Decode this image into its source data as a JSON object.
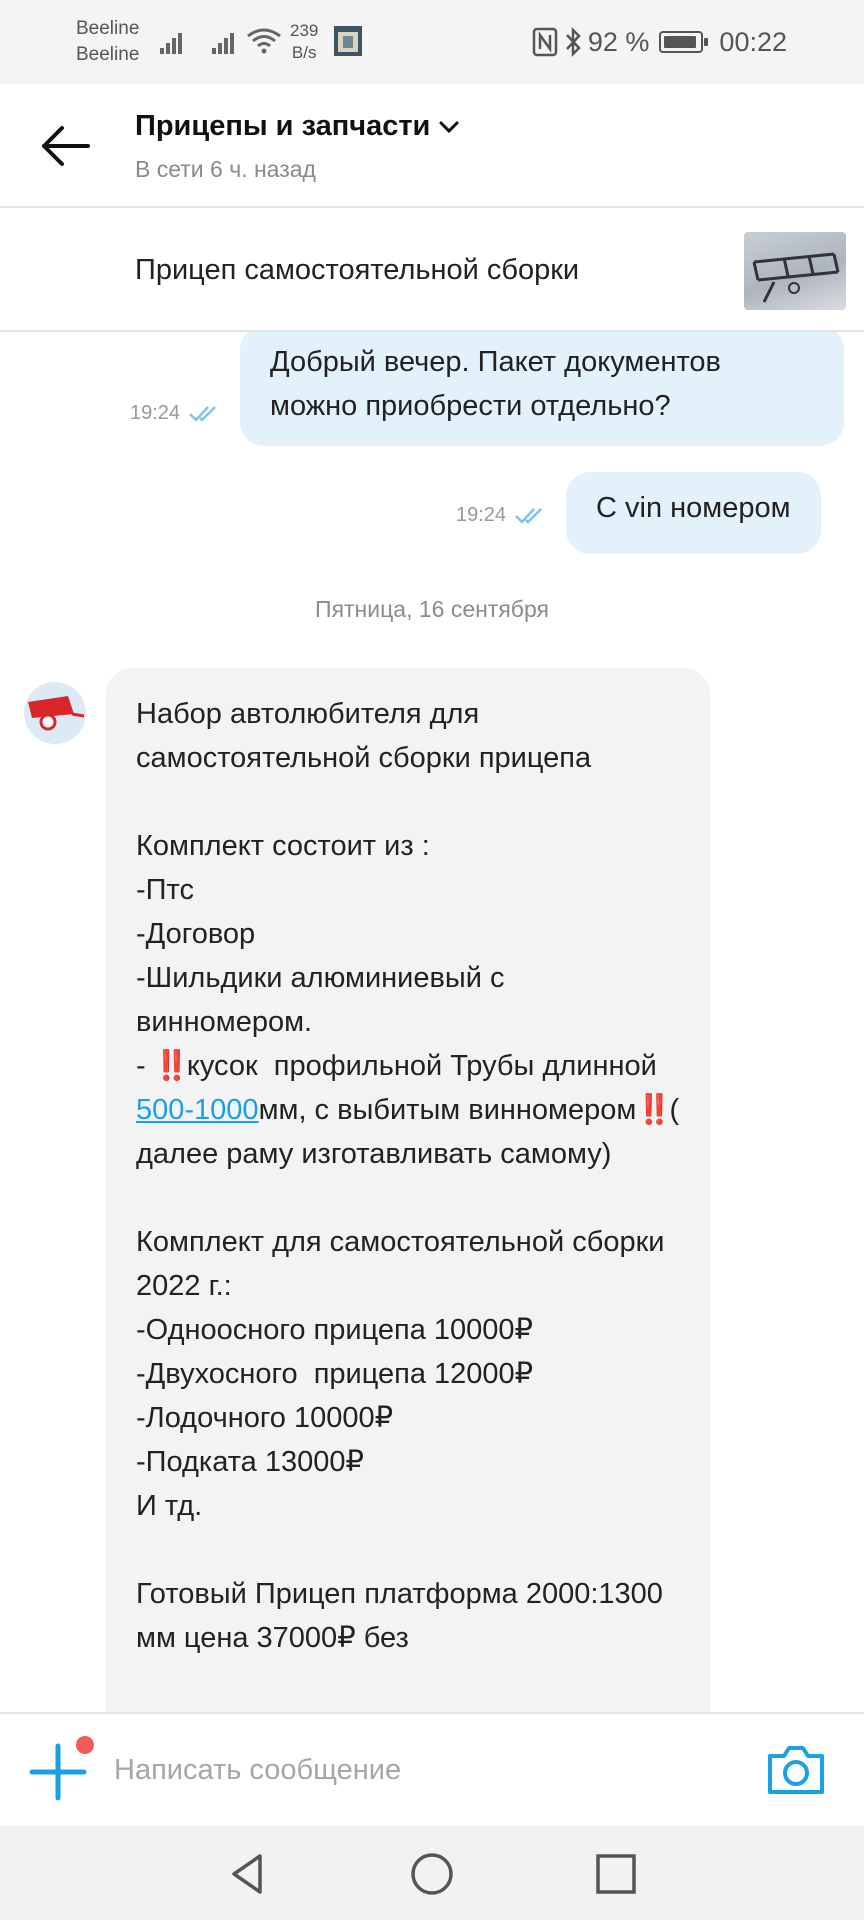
{
  "status_bar": {
    "carrier_1": "Beeline",
    "carrier_2": "Beeline",
    "net_speed_value": "239",
    "net_speed_unit": "B/s",
    "battery_text": "92 %",
    "battery_level": 0.92,
    "time": "00:22"
  },
  "header": {
    "title": "Прицепы и запчасти",
    "subtitle": "В сети 6 ч. назад"
  },
  "ad": {
    "title": "Прицеп самостоятельной сборки"
  },
  "messages": {
    "outgoing": [
      {
        "text": "Добрый вечер. Пакет документов можно приобрести отдельно?",
        "time": "19:24"
      },
      {
        "text": "С vin номером",
        "time": "19:24"
      }
    ],
    "date_separator": "Пятница, 16 сентября",
    "incoming": {
      "intro": "Набор автолюбителя для самостоятельной сборки прицепа\n\nКомплект состоит из :\n-Птс\n-Договор\n-Шильдики алюминиевый с винномером.\n- ",
      "bang_1": "‼️",
      "part_2": "кусок  профильной Трубы длинной ",
      "link": "500-1000",
      "part_3": "мм, с выбитым винномером",
      "bang_2": "‼️",
      "outro": "( далее раму изготавливать самому)\n\nКомплект для самостоятельной сборки  2022 г.:\n-Одноосного прицепа 10000₽\n-Двухосного  прицепа 12000₽\n-Лодочного 10000₽\n-Подката 13000₽\nИ тд.\n\nГотовый Прицеп платформа 2000:1300 мм цена 37000₽ без"
    }
  },
  "composer": {
    "placeholder": "Написать сообщение"
  },
  "colors": {
    "outgoing_bubble": "#e3f1fb",
    "incoming_bubble": "#f3f3f3",
    "accent_blue": "#1aa0e6",
    "read_check": "#7cc4ec",
    "badge_red": "#f25b5b"
  },
  "icons": [
    "signal-icon",
    "wifi-icon",
    "app-notification-icon",
    "nfc-icon",
    "bluetooth-icon",
    "battery-icon",
    "back-arrow-icon",
    "chevron-down-icon",
    "double-check-icon",
    "plus-icon",
    "camera-icon",
    "nav-back-icon",
    "nav-home-icon",
    "nav-recents-icon"
  ]
}
